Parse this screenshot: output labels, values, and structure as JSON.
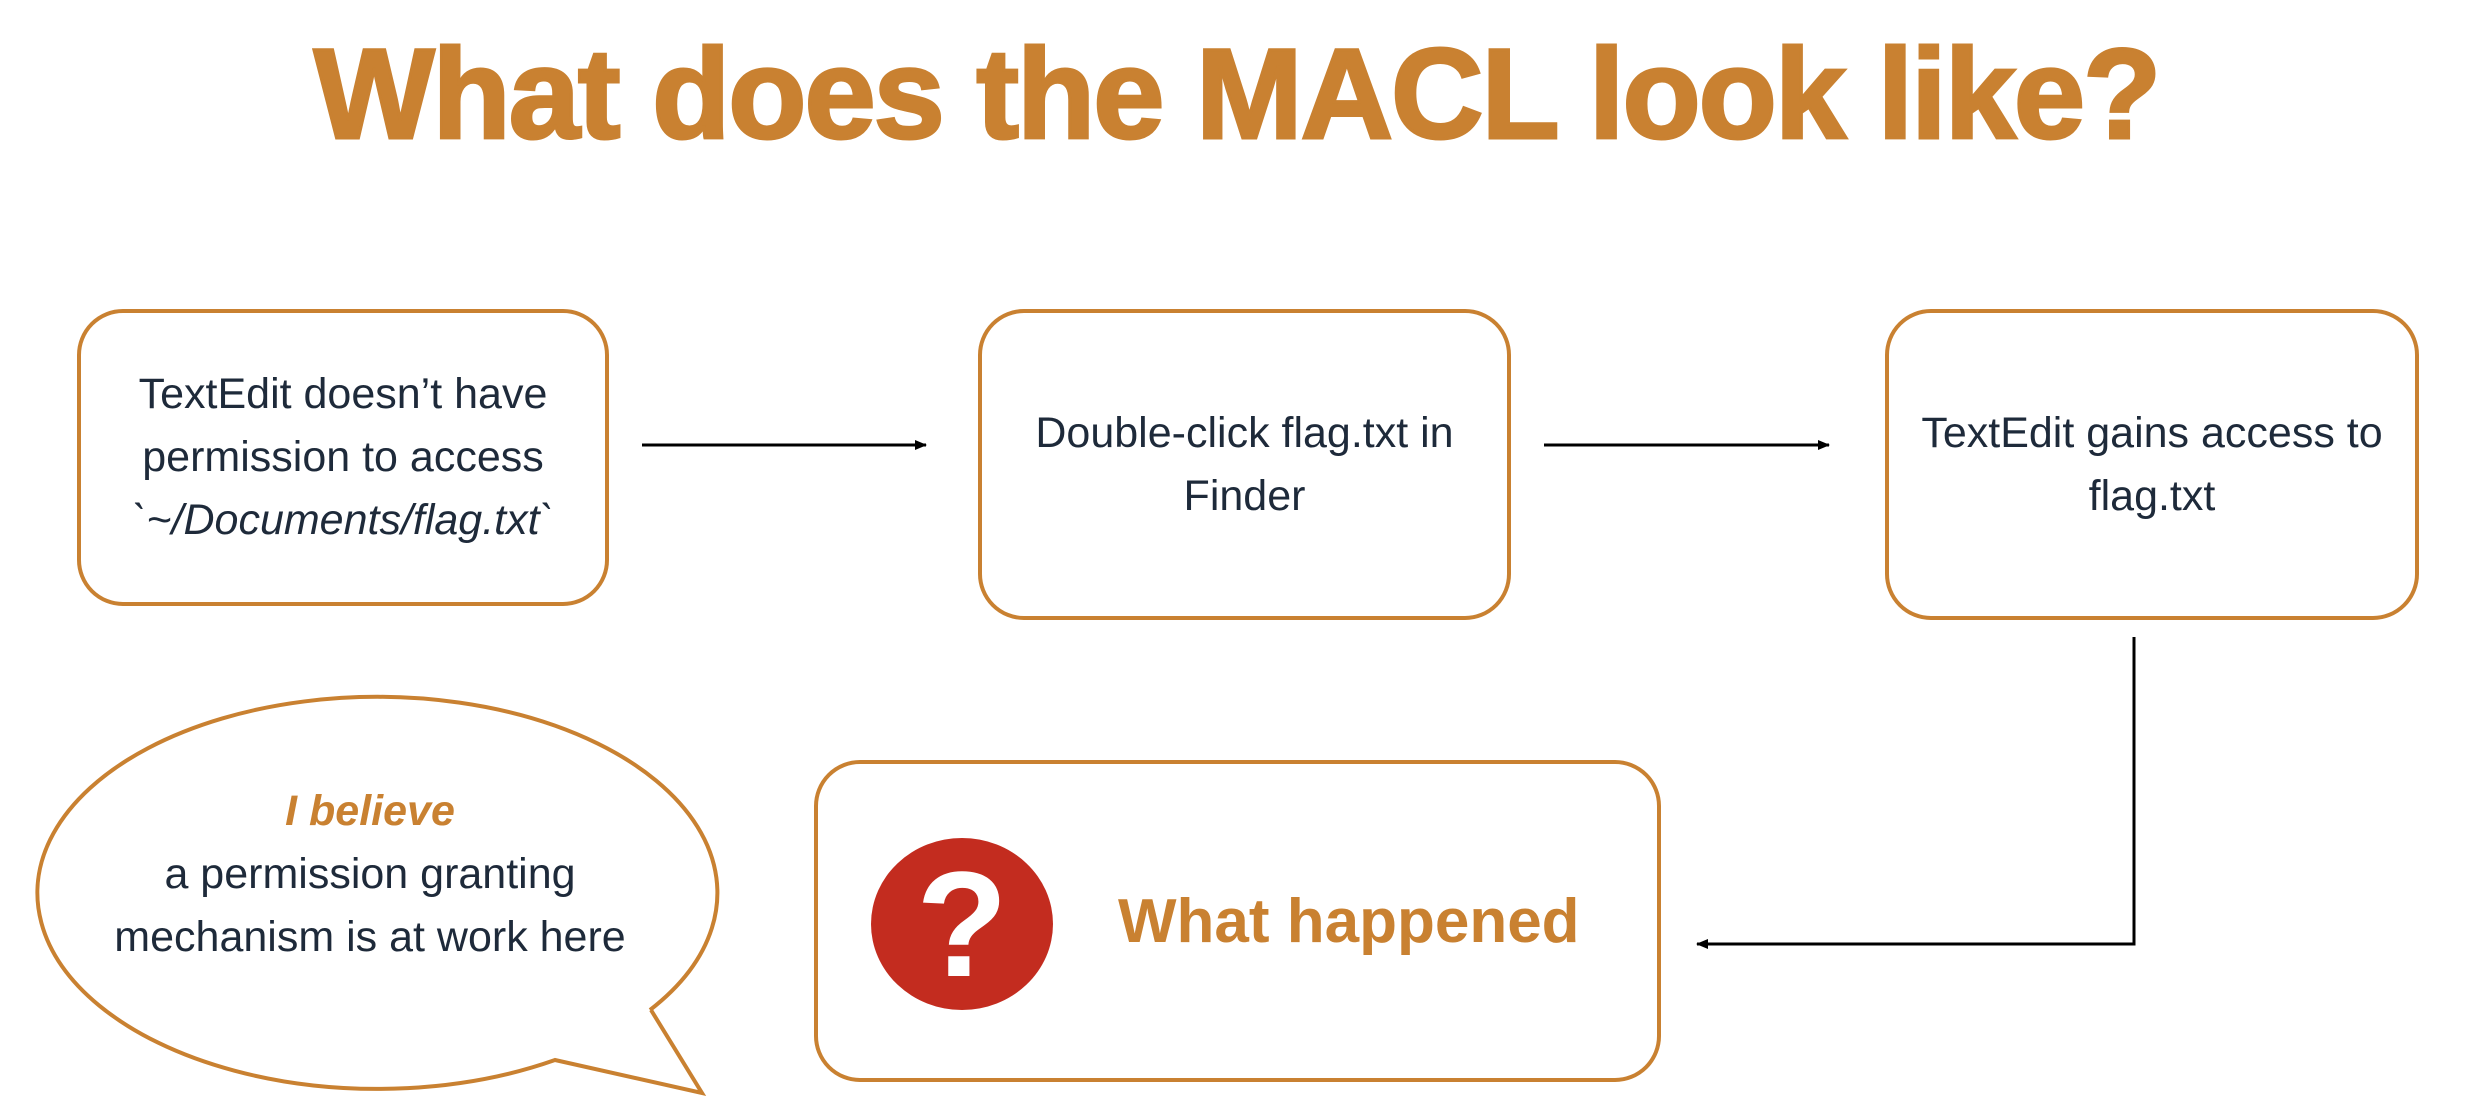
{
  "title": "What does the MACL look like?",
  "steps": [
    {
      "lines": [
        "TextEdit doesn’t have",
        "permission to access"
      ],
      "path": "`~/Documents/flag.txt`"
    },
    {
      "lines": [
        "Double-click flag.txt in",
        "Finder"
      ]
    },
    {
      "lines": [
        "TextEdit gains access to",
        "flag.txt"
      ]
    }
  ],
  "result": {
    "icon": "question-icon",
    "icon_glyph": "?",
    "label": "What happened"
  },
  "bubble": {
    "emphasis": "I believe",
    "lines": [
      "a permission granting",
      "mechanism is at work here"
    ]
  },
  "colors": {
    "accent": "#c98131",
    "text": "#1e2a3a",
    "icon_red": "#c32c1f",
    "arrow": "#000000"
  }
}
